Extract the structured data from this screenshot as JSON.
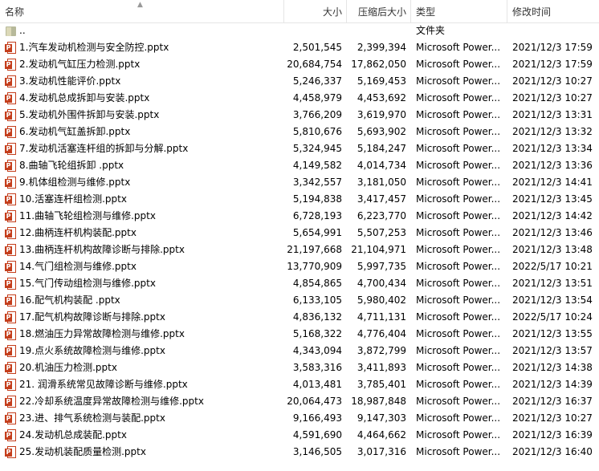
{
  "columns": {
    "name": "名称",
    "size": "大小",
    "compressed": "压缩后大小",
    "type": "类型",
    "modified": "修改时间"
  },
  "parent_row": {
    "name": "..",
    "type": "文件夹"
  },
  "files": [
    {
      "name": "1.汽车发动机检测与安全防控.pptx",
      "size": "2,501,545",
      "compressed": "2,399,394",
      "type": "Microsoft Power...",
      "modified": "2021/12/3 17:59"
    },
    {
      "name": "2.发动机气缸压力检测.pptx",
      "size": "20,684,754",
      "compressed": "17,862,050",
      "type": "Microsoft Power...",
      "modified": "2021/12/3 17:59"
    },
    {
      "name": "3.发动机性能评价.pptx",
      "size": "5,246,337",
      "compressed": "5,169,453",
      "type": "Microsoft Power...",
      "modified": "2021/12/3 10:27"
    },
    {
      "name": "4.发动机总成拆卸与安装.pptx",
      "size": "4,458,979",
      "compressed": "4,453,692",
      "type": "Microsoft Power...",
      "modified": "2021/12/3 10:27"
    },
    {
      "name": "5.发动机外围件拆卸与安装.pptx",
      "size": "3,766,209",
      "compressed": "3,619,970",
      "type": "Microsoft Power...",
      "modified": "2021/12/3 13:31"
    },
    {
      "name": "6.发动机气缸盖拆卸.pptx",
      "size": "5,810,676",
      "compressed": "5,693,902",
      "type": "Microsoft Power...",
      "modified": "2021/12/3 13:32"
    },
    {
      "name": "7.发动机活塞连杆组的拆卸与分解.pptx",
      "size": "5,324,945",
      "compressed": "5,184,247",
      "type": "Microsoft Power...",
      "modified": "2021/12/3 13:34"
    },
    {
      "name": "8.曲轴飞轮组拆卸 .pptx",
      "size": "4,149,582",
      "compressed": "4,014,734",
      "type": "Microsoft Power...",
      "modified": "2021/12/3 13:36"
    },
    {
      "name": "9.机体组检测与维修.pptx",
      "size": "3,342,557",
      "compressed": "3,181,050",
      "type": "Microsoft Power...",
      "modified": "2021/12/3 14:41"
    },
    {
      "name": "10.活塞连杆组检测.pptx",
      "size": "5,194,838",
      "compressed": "3,417,457",
      "type": "Microsoft Power...",
      "modified": "2021/12/3 13:45"
    },
    {
      "name": "11.曲轴飞轮组检测与维修.pptx",
      "size": "6,728,193",
      "compressed": "6,223,770",
      "type": "Microsoft Power...",
      "modified": "2021/12/3 14:42"
    },
    {
      "name": "12.曲柄连杆机构装配.pptx",
      "size": "5,654,991",
      "compressed": "5,507,253",
      "type": "Microsoft Power...",
      "modified": "2021/12/3 13:46"
    },
    {
      "name": "13.曲柄连杆机构故障诊断与排除.pptx",
      "size": "21,197,668",
      "compressed": "21,104,971",
      "type": "Microsoft Power...",
      "modified": "2021/12/3 13:48"
    },
    {
      "name": "14.气门组检测与维修.pptx",
      "size": "13,770,909",
      "compressed": "5,997,735",
      "type": "Microsoft Power...",
      "modified": "2022/5/17 10:21"
    },
    {
      "name": "15.气门传动组检测与维修.pptx",
      "size": "4,854,865",
      "compressed": "4,700,434",
      "type": "Microsoft Power...",
      "modified": "2021/12/3 13:51"
    },
    {
      "name": "16.配气机构装配 .pptx",
      "size": "6,133,105",
      "compressed": "5,980,402",
      "type": "Microsoft Power...",
      "modified": "2021/12/3 13:54"
    },
    {
      "name": "17.配气机构故障诊断与排除.pptx",
      "size": "4,836,132",
      "compressed": "4,711,131",
      "type": "Microsoft Power...",
      "modified": "2022/5/17 10:24"
    },
    {
      "name": "18.燃油压力异常故障检测与维修.pptx",
      "size": "5,168,322",
      "compressed": "4,776,404",
      "type": "Microsoft Power...",
      "modified": "2021/12/3 13:55"
    },
    {
      "name": "19.点火系统故障检测与维修.pptx",
      "size": "4,343,094",
      "compressed": "3,872,799",
      "type": "Microsoft Power...",
      "modified": "2021/12/3 13:57"
    },
    {
      "name": "20.机油压力检测.pptx",
      "size": "3,583,316",
      "compressed": "3,411,893",
      "type": "Microsoft Power...",
      "modified": "2021/12/3 14:38"
    },
    {
      "name": "21. 润滑系统常见故障诊断与维修.pptx",
      "size": "4,013,481",
      "compressed": "3,785,401",
      "type": "Microsoft Power...",
      "modified": "2021/12/3 14:39"
    },
    {
      "name": "22.冷却系统温度异常故障检测与维修.pptx",
      "size": "20,064,473",
      "compressed": "18,987,848",
      "type": "Microsoft Power...",
      "modified": "2021/12/3 16:37"
    },
    {
      "name": "23.进、排气系统检测与装配.pptx",
      "size": "9,166,493",
      "compressed": "9,147,303",
      "type": "Microsoft Power...",
      "modified": "2021/12/3 10:27"
    },
    {
      "name": "24.发动机总成装配.pptx",
      "size": "4,591,690",
      "compressed": "4,464,662",
      "type": "Microsoft Power...",
      "modified": "2021/12/3 16:39"
    },
    {
      "name": "25.发动机装配质量检测.pptx",
      "size": "3,146,505",
      "compressed": "3,017,316",
      "type": "Microsoft Power...",
      "modified": "2021/12/3 16:40"
    }
  ],
  "icons": {
    "file": "powerpoint-file-icon",
    "folder": "folder-icon",
    "sort": "sort-up-icon"
  },
  "colors": {
    "ppt_accent": "#c43e1c",
    "folder": "#b7b99a"
  }
}
